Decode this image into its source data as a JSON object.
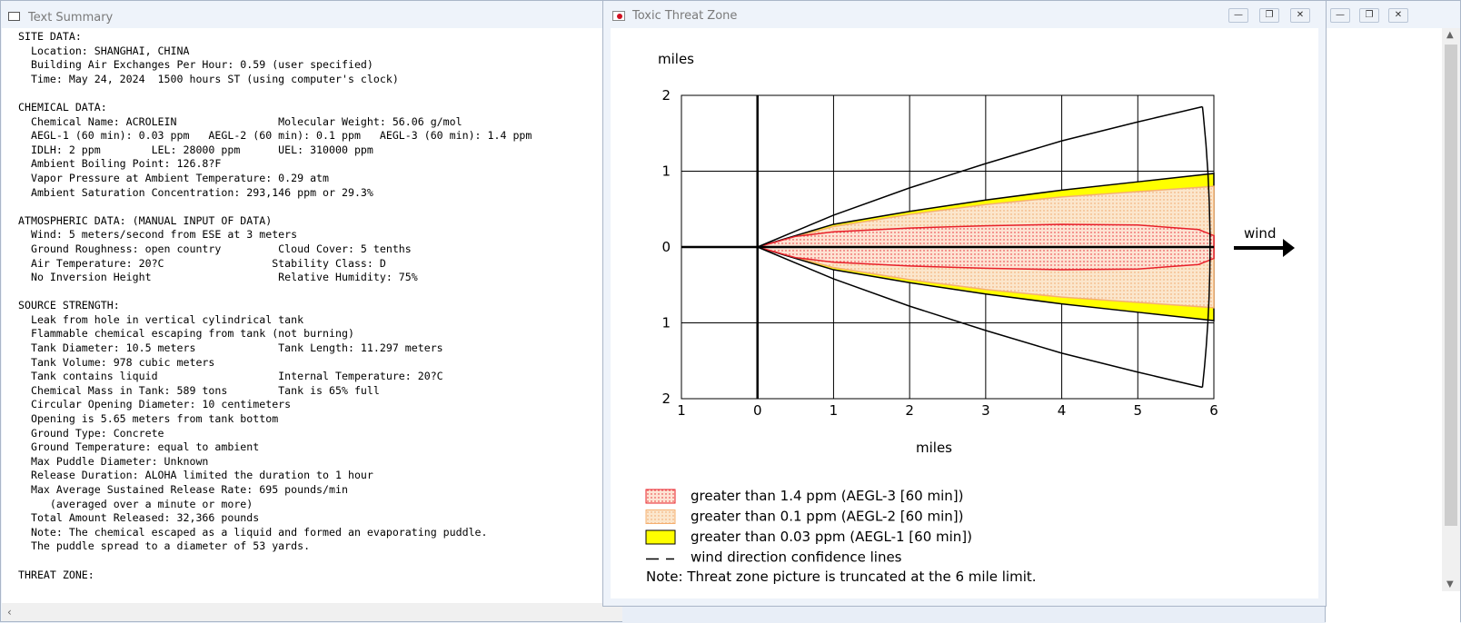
{
  "text_summary": {
    "title": "Text Summary",
    "lines": [
      "SITE DATA:",
      "  Location: SHANGHAI, CHINA",
      "  Building Air Exchanges Per Hour: 0.59 (user specified)",
      "  Time: May 24, 2024  1500 hours ST (using computer's clock)",
      "",
      "CHEMICAL DATA:",
      "  Chemical Name: ACROLEIN                Molecular Weight: 56.06 g/mol",
      "  AEGL-1 (60 min): 0.03 ppm   AEGL-2 (60 min): 0.1 ppm   AEGL-3 (60 min): 1.4 ppm",
      "  IDLH: 2 ppm        LEL: 28000 ppm      UEL: 310000 ppm",
      "  Ambient Boiling Point: 126.8?F",
      "  Vapor Pressure at Ambient Temperature: 0.29 atm",
      "  Ambient Saturation Concentration: 293,146 ppm or 29.3%",
      "",
      "ATMOSPHERIC DATA: (MANUAL INPUT OF DATA)",
      "  Wind: 5 meters/second from ESE at 3 meters",
      "  Ground Roughness: open country         Cloud Cover: 5 tenths",
      "  Air Temperature: 20?C                 Stability Class: D",
      "  No Inversion Height                    Relative Humidity: 75%",
      "",
      "SOURCE STRENGTH:",
      "  Leak from hole in vertical cylindrical tank",
      "  Flammable chemical escaping from tank (not burning)",
      "  Tank Diameter: 10.5 meters             Tank Length: 11.297 meters",
      "  Tank Volume: 978 cubic meters",
      "  Tank contains liquid                   Internal Temperature: 20?C",
      "  Chemical Mass in Tank: 589 tons        Tank is 65% full",
      "  Circular Opening Diameter: 10 centimeters",
      "  Opening is 5.65 meters from tank bottom",
      "  Ground Type: Concrete",
      "  Ground Temperature: equal to ambient",
      "  Max Puddle Diameter: Unknown",
      "  Release Duration: ALOHA limited the duration to 1 hour",
      "  Max Average Sustained Release Rate: 695 pounds/min",
      "     (averaged over a minute or more)",
      "  Total Amount Released: 32,366 pounds",
      "  Note: The chemical escaped as a liquid and formed an evaporating puddle.",
      "  The puddle spread to a diameter of 53 yards.",
      "",
      "THREAT ZONE:"
    ]
  },
  "threat_zone": {
    "title": "Toxic Threat Zone",
    "y_units": "miles",
    "x_units": "miles",
    "wind_label": "wind",
    "x_ticks": [
      "1",
      "0",
      "1",
      "2",
      "3",
      "4",
      "5",
      "6"
    ],
    "y_ticks": [
      "2",
      "1",
      "0",
      "1",
      "2"
    ],
    "colors": {
      "aegl3": "#e8202a",
      "aegl2": "#f5b070",
      "aegl1": "#ffff00"
    },
    "legend": [
      {
        "label": "greater than 1.4 ppm (AEGL-3 [60 min])"
      },
      {
        "label": "greater than 0.1 ppm (AEGL-2 [60 min])"
      },
      {
        "label": "greater than 0.03 ppm (AEGL-1 [60 min])"
      },
      {
        "label": "wind direction confidence lines"
      }
    ],
    "note": "Note: Threat zone picture is truncated at the 6 mile limit."
  },
  "chart_data": {
    "type": "area",
    "xlabel": "miles",
    "ylabel": "miles",
    "xlim": [
      -1,
      6
    ],
    "ylim": [
      -2,
      2
    ],
    "series": [
      {
        "name": "greater than 1.4 ppm (AEGL-3 [60 min])",
        "x": [
          0,
          0.5,
          1,
          2,
          3,
          4,
          5,
          5.8,
          6
        ],
        "y": [
          0,
          0.14,
          0.2,
          0.25,
          0.28,
          0.3,
          0.29,
          0.23,
          0.15
        ]
      },
      {
        "name": "greater than 0.1 ppm (AEGL-2 [60 min])",
        "x": [
          0,
          1,
          2,
          3,
          4,
          5,
          6
        ],
        "y": [
          0,
          0.27,
          0.43,
          0.56,
          0.66,
          0.73,
          0.8
        ]
      },
      {
        "name": "greater than 0.03 ppm (AEGL-1 [60 min])",
        "x": [
          0,
          1,
          2,
          3,
          4,
          5,
          6
        ],
        "y": [
          0,
          0.3,
          0.47,
          0.62,
          0.75,
          0.86,
          0.97
        ]
      },
      {
        "name": "wind direction confidence lines",
        "x": [
          0,
          1,
          2,
          3,
          4,
          5,
          5.85
        ],
        "y": [
          0,
          0.42,
          0.78,
          1.1,
          1.4,
          1.65,
          1.85
        ]
      }
    ]
  }
}
